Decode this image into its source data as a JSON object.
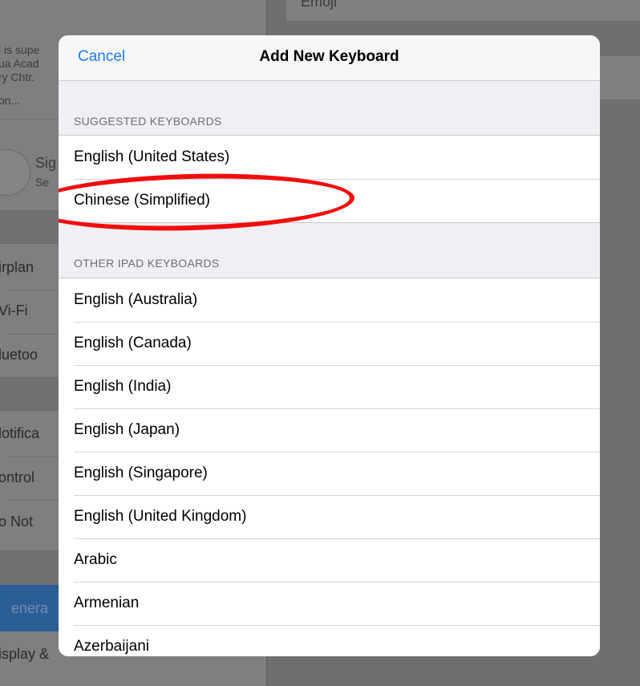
{
  "background": {
    "emoji_row_label": "Emoji",
    "profile_snippet": [
      "l is supe",
      "ua Acad",
      "ry Chtr.",
      "on..."
    ],
    "profile_label": [
      "Sig",
      "Se"
    ],
    "sidebar_items": [
      "irplan",
      "Vi-Fi",
      "luetoo",
      "lotifica",
      "ontrol",
      "o Not",
      "enera",
      "isplay &"
    ]
  },
  "modal": {
    "cancel_label": "Cancel",
    "title": "Add New Keyboard",
    "suggested_header": "SUGGESTED KEYBOARDS",
    "suggested": [
      "English (United States)",
      "Chinese (Simplified)"
    ],
    "other_header": "OTHER IPAD KEYBOARDS",
    "other": [
      "English (Australia)",
      "English (Canada)",
      "English (India)",
      "English (Japan)",
      "English (Singapore)",
      "English (United Kingdom)",
      "Arabic",
      "Armenian",
      "Azerbaijani"
    ]
  },
  "annotation": {
    "highlight_color": "#f20d0d",
    "highlighted_item": "Chinese (Simplified)"
  }
}
